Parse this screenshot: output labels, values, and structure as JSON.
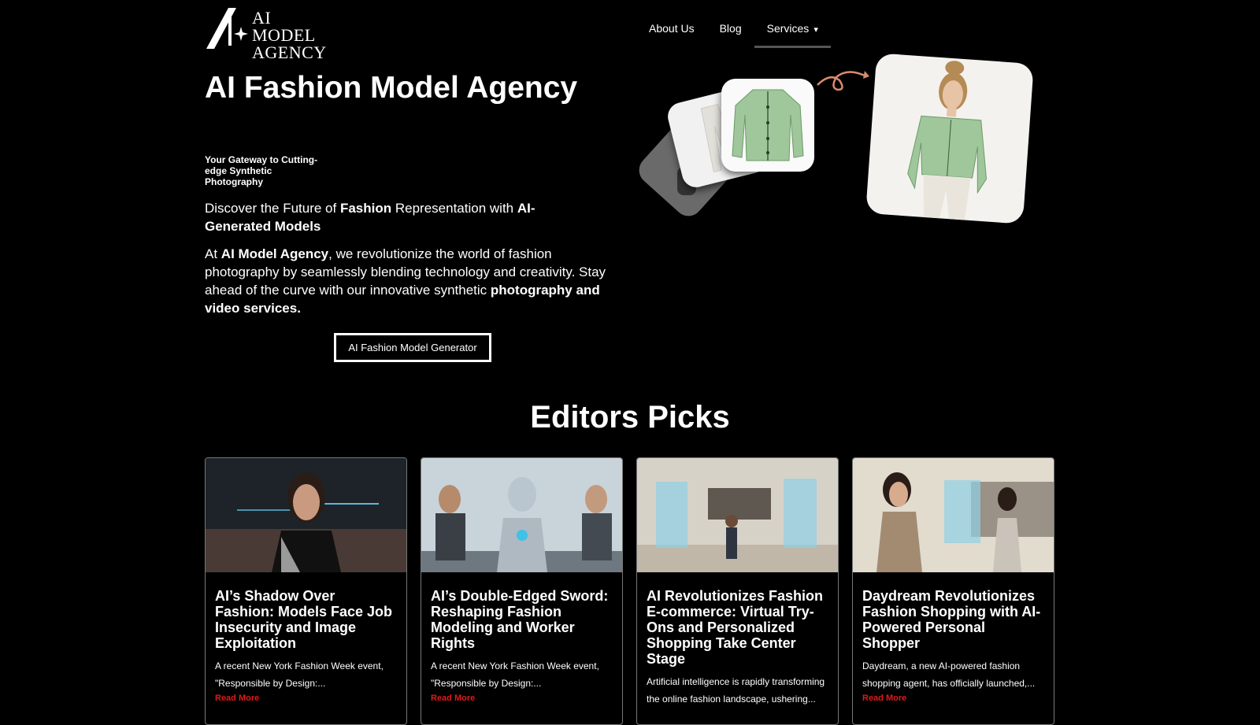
{
  "header": {
    "logo_line1": "AI MODEL",
    "logo_line2": "AGENCY",
    "nav": [
      {
        "label": "About Us"
      },
      {
        "label": "Blog"
      },
      {
        "label": "Services",
        "icon": "chevron-down-icon"
      }
    ]
  },
  "hero": {
    "title": "AI Fashion Model Agency",
    "tagline": "Your Gateway to Cutting-edge Synthetic Photography",
    "p1_pre": "Discover the Future of ",
    "p1_b1": "Fashion",
    "p1_mid": " Representation with ",
    "p1_b2": "AI-Generated Models",
    "p2_pre": "At ",
    "p2_b1": "AI Model Agency",
    "p2_mid": ", we revolutionize the world of fashion photography by seamlessly blending technology and creativity. Stay ahead of the curve with our innovative synthetic ",
    "p2_b2": "photography and video services.",
    "cta": "AI Fashion Model Generator"
  },
  "colors": {
    "background": "#000000",
    "read_more": "#e01a1a",
    "shirt": "#9fc79b"
  },
  "editors": {
    "title": "Editors Picks",
    "cards": [
      {
        "title": "AI’s Shadow Over Fashion: Models Face Job Insecurity and Image Exploitation",
        "excerpt": "A recent New York Fashion Week event, \"Responsible by Design:...",
        "more": "Read More"
      },
      {
        "title": "AI’s Double-Edged Sword: Reshaping Fashion Modeling and Worker Rights",
        "excerpt": "A recent New York Fashion Week event, \"Responsible by Design:...",
        "more": "Read More"
      },
      {
        "title": "AI Revolutionizes Fashion E-commerce: Virtual Try-Ons and Personalized Shopping Take Center Stage",
        "excerpt": "Artificial intelligence is rapidly transforming the online fashion landscape, ushering...",
        "more": ""
      },
      {
        "title": "Daydream Revolutionizes Fashion Shopping with AI-Powered Personal Shopper",
        "excerpt": "Daydream, a new AI-powered fashion shopping agent, has officially launched,...",
        "more": "Read More"
      }
    ]
  }
}
